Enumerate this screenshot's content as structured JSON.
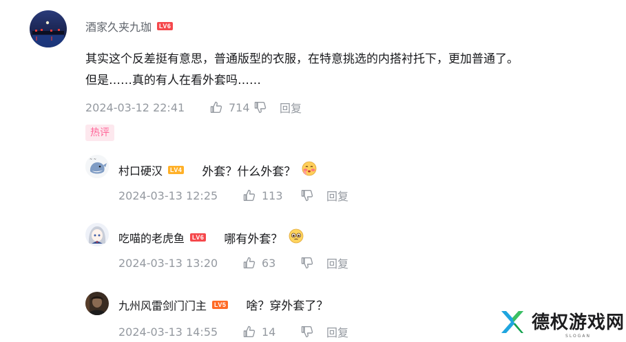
{
  "main_comment": {
    "username": "酒家久夹九珈",
    "level": "LV6",
    "level_color": "#f5484c",
    "text_line1": "其实这个反差挺有意思，普通版型的衣服，在特意挑选的内搭衬托下，更加普通了。",
    "text_line2": "但是……真的有人在看外套吗……",
    "timestamp": "2024-03-12 22:41",
    "likes": "714",
    "reply_label": "回复"
  },
  "hot_tag": "热评",
  "replies": [
    {
      "username": "村口硬汉",
      "level": "LV4",
      "level_color": "#ffb027",
      "text": "外套？什么外套？",
      "emoji": "blushing-face-icon",
      "timestamp": "2024-03-13 12:25",
      "likes": "113",
      "reply_label": "回复"
    },
    {
      "username": "吃喵的老虎鱼",
      "level": "LV6",
      "level_color": "#f5484c",
      "text": "哪有外套？",
      "emoji": "pleading-face-icon",
      "timestamp": "2024-03-13 13:20",
      "likes": "63",
      "reply_label": "回复"
    },
    {
      "username": "九州风雷剑门门主",
      "level": "LV5",
      "level_color": "#ff6b26",
      "text": "啥？穿外套了？",
      "timestamp": "2024-03-13 14:55",
      "likes": "14",
      "reply_label": "回复"
    }
  ],
  "watermark": {
    "brand": "德权游戏网",
    "slogan": "SLOGAN"
  }
}
